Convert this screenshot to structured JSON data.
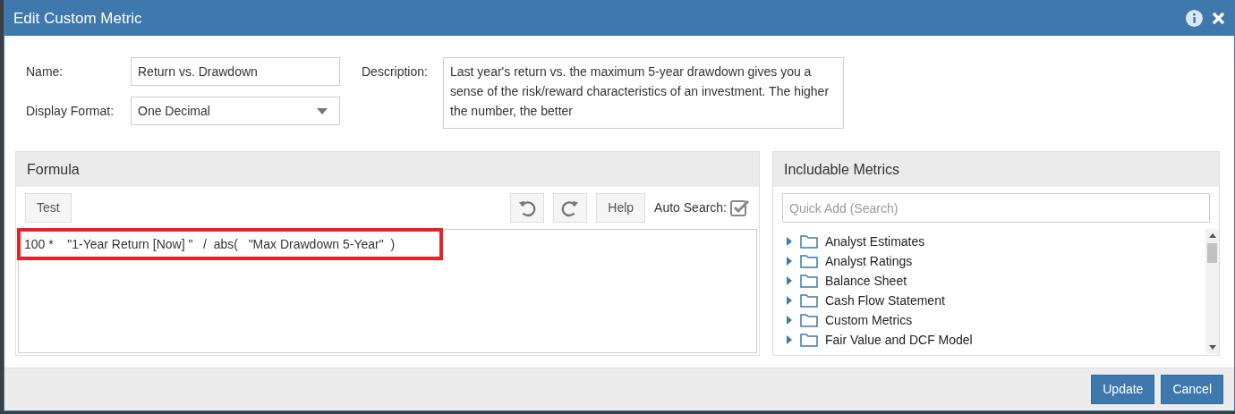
{
  "window": {
    "title": "Edit Custom Metric"
  },
  "form": {
    "name_label": "Name:",
    "name_value": "Return vs. Drawdown",
    "format_label": "Display Format:",
    "format_value": "One Decimal",
    "description_label": "Description:",
    "description_value": "Last year's return vs. the maximum 5-year drawdown gives you a sense of the risk/reward characteristics of an investment. The higher the number, the better"
  },
  "formula": {
    "title": "Formula",
    "test_button": "Test",
    "help_button": "Help",
    "auto_search_label": "Auto Search:",
    "auto_search_checked": true,
    "text": "100 *    \"1-Year Return [Now] \"   /  abs(   \"Max Drawdown 5-Year\"  )"
  },
  "metrics": {
    "title": "Includable Metrics",
    "search_placeholder": "Quick Add (Search)",
    "items": [
      {
        "label": "Analyst Estimates",
        "expanded": false
      },
      {
        "label": "Analyst Ratings",
        "expanded": false
      },
      {
        "label": "Balance Sheet",
        "expanded": false
      },
      {
        "label": "Cash Flow Statement",
        "expanded": false
      },
      {
        "label": "Custom Metrics",
        "expanded": false
      },
      {
        "label": "Fair Value and DCF Model",
        "expanded": false
      }
    ]
  },
  "buttons": [
    "Update",
    "Cancel"
  ]
}
